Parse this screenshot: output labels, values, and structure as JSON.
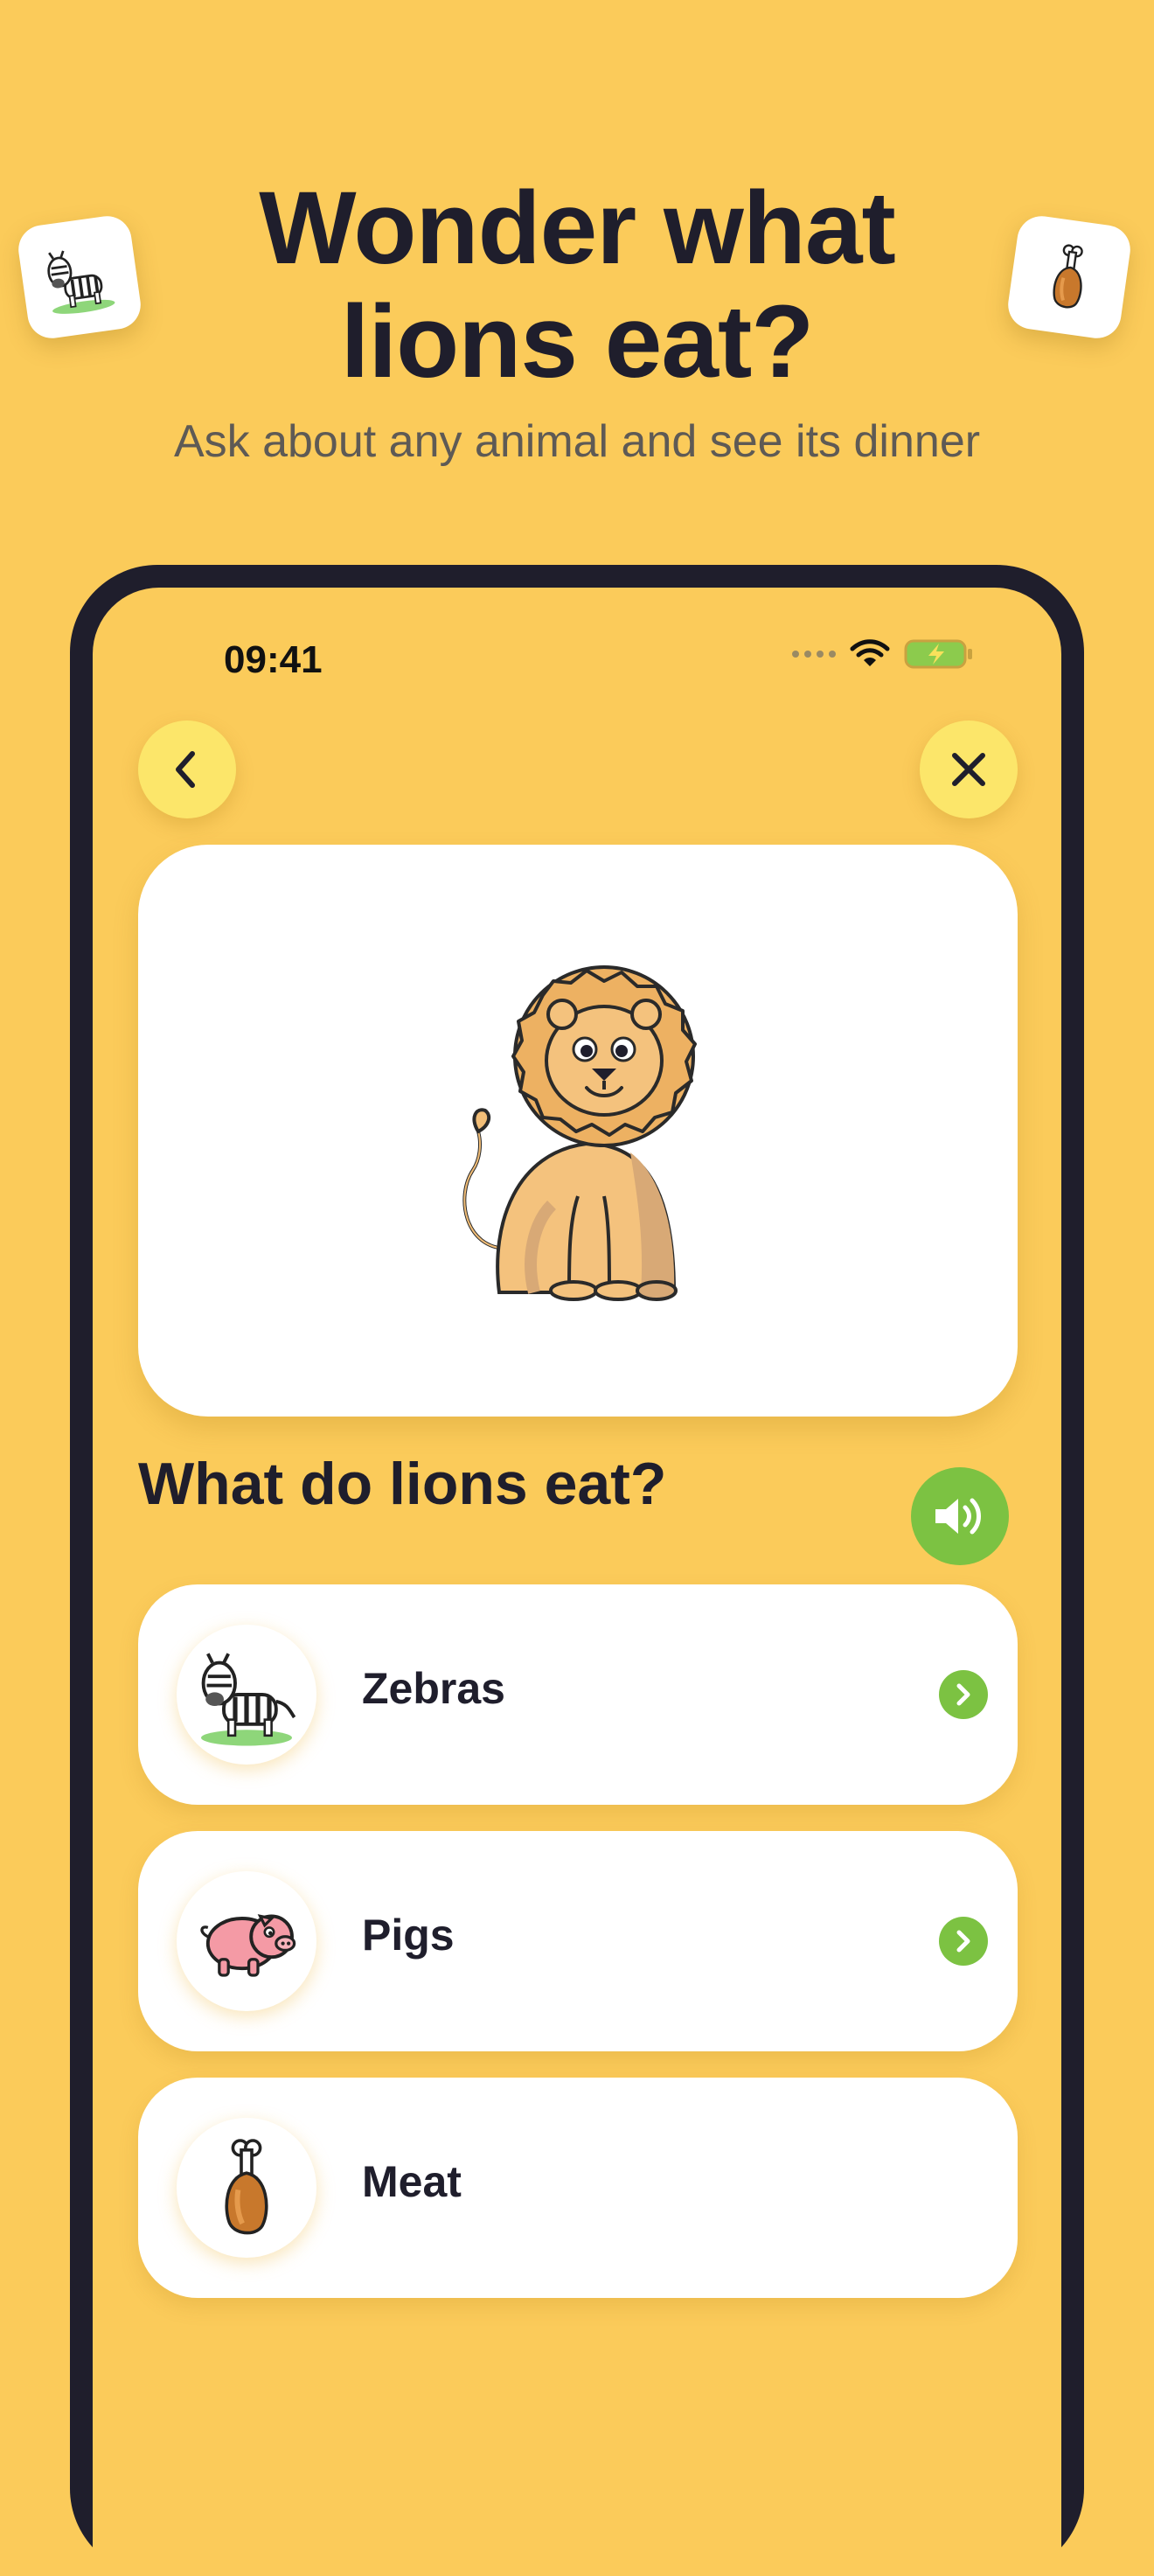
{
  "promo": {
    "headline_line1": "Wonder what",
    "headline_line2": "lions eat?",
    "subtitle": "Ask about any animal and see its dinner"
  },
  "status_bar": {
    "time": "09:41",
    "icons": [
      "signal-dots-icon",
      "wifi-icon",
      "battery-charging-icon"
    ]
  },
  "nav": {
    "back_icon": "chevron-left-icon",
    "close_icon": "close-icon"
  },
  "hero": {
    "image": "lion-illustration"
  },
  "question": {
    "text": "What do lions eat?",
    "sound_icon": "speaker-icon"
  },
  "options": [
    {
      "label": "Zebras",
      "icon": "zebra-icon",
      "has_arrow": true
    },
    {
      "label": "Pigs",
      "icon": "pig-icon",
      "has_arrow": true
    },
    {
      "label": "Meat",
      "icon": "meat-drumstick-icon",
      "has_arrow": false
    }
  ],
  "colors": {
    "background": "#FBCB5A",
    "accent_green": "#7CC242",
    "button_yellow": "#FCE66A",
    "dark": "#1F1E2C"
  }
}
